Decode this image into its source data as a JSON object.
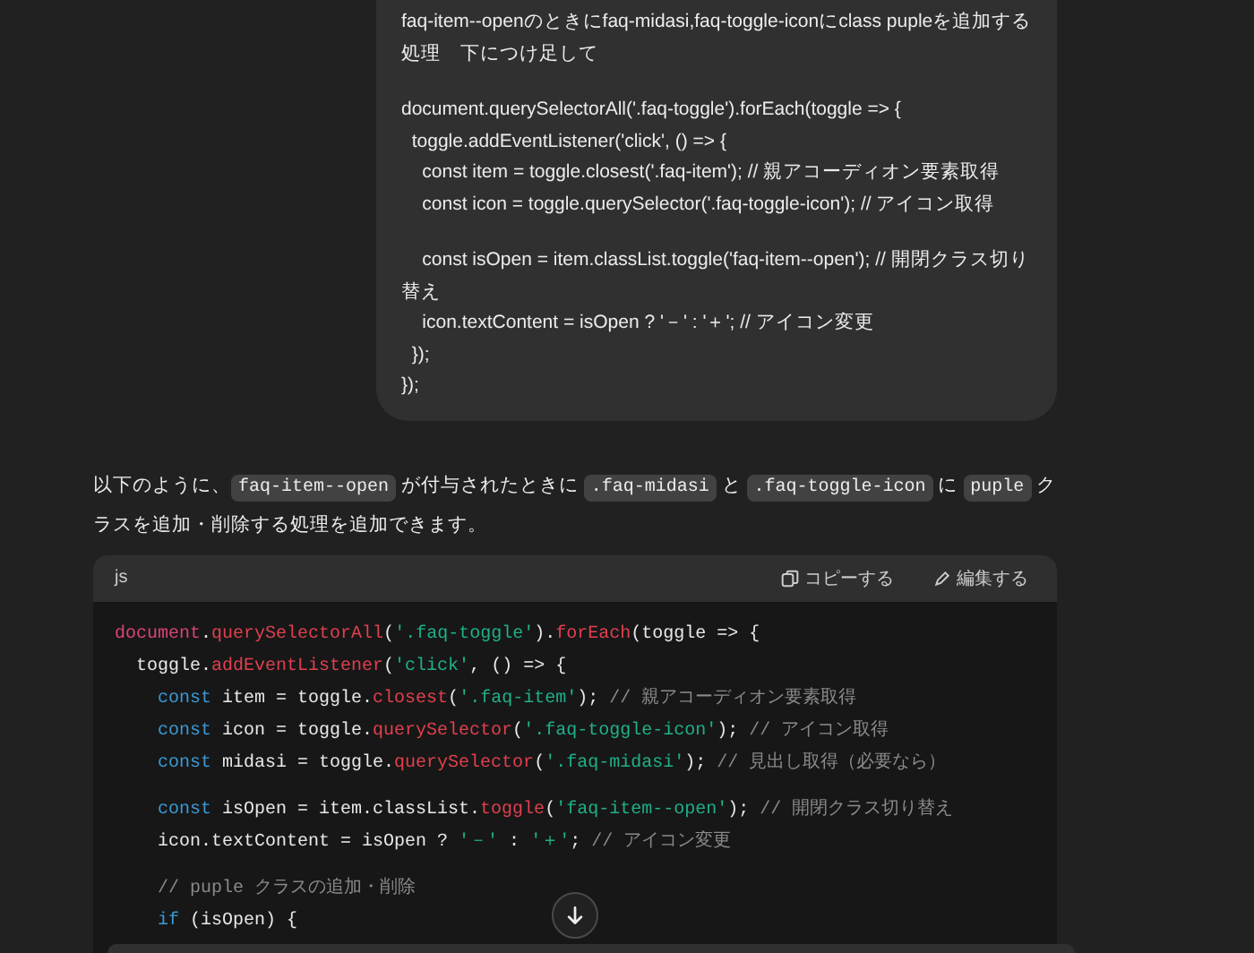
{
  "user_message": {
    "prompt": "faq-item--openのときにfaq-midasi,faq-toggle-iconにclass pupleを追加する処理　下につけ足して",
    "code_groups": [
      [
        "document.querySelectorAll('.faq-toggle').forEach(toggle => {",
        "  toggle.addEventListener('click', () => {",
        "    const item = toggle.closest('.faq-item'); // 親アコーディオン要素取得",
        "    const icon = toggle.querySelector('.faq-toggle-icon'); // アイコン取得"
      ],
      [
        "    const isOpen = item.classList.toggle('faq-item--open'); // 開閉クラス切り替え",
        "    icon.textContent = isOpen ? '－' : '＋'; // アイコン変更",
        "  });",
        "});"
      ]
    ]
  },
  "reply": {
    "paragraph": [
      {
        "kind": "text",
        "text": "以下のように、"
      },
      {
        "kind": "code",
        "text": "faq-item--open"
      },
      {
        "kind": "text",
        "text": " が付与されたときに "
      },
      {
        "kind": "code",
        "text": ".faq-midasi"
      },
      {
        "kind": "text",
        "text": " と "
      },
      {
        "kind": "code",
        "text": ".faq-toggle-icon"
      },
      {
        "kind": "text",
        "text": " に "
      },
      {
        "kind": "code",
        "text": "puple"
      },
      {
        "kind": "text",
        "text": " クラスを追加・削除する処理を追加できます。"
      }
    ],
    "code_block": {
      "language": "js",
      "copy_label": "コピーする",
      "edit_label": "編集する",
      "sections": [
        [
          [
            {
              "kind": "obj",
              "text": "document"
            },
            {
              "kind": "plain",
              "text": "."
            },
            {
              "kind": "fn",
              "text": "querySelectorAll"
            },
            {
              "kind": "plain",
              "text": "("
            },
            {
              "kind": "str",
              "text": "'.faq-toggle'"
            },
            {
              "kind": "plain",
              "text": ")."
            },
            {
              "kind": "fn",
              "text": "forEach"
            },
            {
              "kind": "plain",
              "text": "(toggle => {"
            }
          ],
          [
            {
              "kind": "plain",
              "text": "  toggle."
            },
            {
              "kind": "fn",
              "text": "addEventListener"
            },
            {
              "kind": "plain",
              "text": "("
            },
            {
              "kind": "str",
              "text": "'click'"
            },
            {
              "kind": "plain",
              "text": ", () => {"
            }
          ],
          [
            {
              "kind": "kw",
              "text": "    const"
            },
            {
              "kind": "plain",
              "text": " item = toggle."
            },
            {
              "kind": "fn",
              "text": "closest"
            },
            {
              "kind": "plain",
              "text": "("
            },
            {
              "kind": "str",
              "text": "'.faq-item'"
            },
            {
              "kind": "plain",
              "text": "); "
            },
            {
              "kind": "cm",
              "text": "// 親アコーディオン要素取得"
            }
          ],
          [
            {
              "kind": "kw",
              "text": "    const"
            },
            {
              "kind": "plain",
              "text": " icon = toggle."
            },
            {
              "kind": "fn",
              "text": "querySelector"
            },
            {
              "kind": "plain",
              "text": "("
            },
            {
              "kind": "str",
              "text": "'.faq-toggle-icon'"
            },
            {
              "kind": "plain",
              "text": "); "
            },
            {
              "kind": "cm",
              "text": "// アイコン取得"
            }
          ],
          [
            {
              "kind": "kw",
              "text": "    const"
            },
            {
              "kind": "plain",
              "text": " midasi = toggle."
            },
            {
              "kind": "fn",
              "text": "querySelector"
            },
            {
              "kind": "plain",
              "text": "("
            },
            {
              "kind": "str",
              "text": "'.faq-midasi'"
            },
            {
              "kind": "plain",
              "text": "); "
            },
            {
              "kind": "cm",
              "text": "// 見出し取得（必要なら）"
            }
          ]
        ],
        [
          [
            {
              "kind": "kw",
              "text": "    const"
            },
            {
              "kind": "plain",
              "text": " isOpen = item.classList."
            },
            {
              "kind": "fn",
              "text": "toggle"
            },
            {
              "kind": "plain",
              "text": "("
            },
            {
              "kind": "str",
              "text": "'faq-item--open'"
            },
            {
              "kind": "plain",
              "text": "); "
            },
            {
              "kind": "cm",
              "text": "// 開閉クラス切り替え"
            }
          ],
          [
            {
              "kind": "plain",
              "text": "    icon.textContent = isOpen ? "
            },
            {
              "kind": "str",
              "text": "'－'"
            },
            {
              "kind": "plain",
              "text": " : "
            },
            {
              "kind": "str",
              "text": "'＋'"
            },
            {
              "kind": "plain",
              "text": "; "
            },
            {
              "kind": "cm",
              "text": "// アイコン変更"
            }
          ]
        ],
        [
          [
            {
              "kind": "cm",
              "text": "    // puple クラスの追加・削除"
            }
          ],
          [
            {
              "kind": "kw",
              "text": "    if"
            },
            {
              "kind": "plain",
              "text": " (isOpen) {"
            }
          ]
        ]
      ]
    }
  }
}
